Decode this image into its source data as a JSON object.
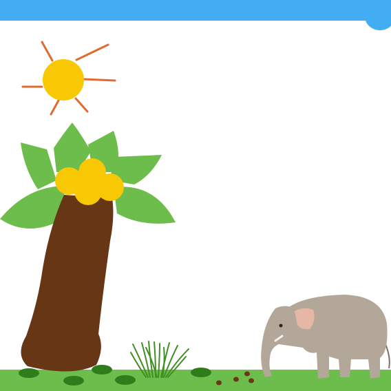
{
  "scene": {
    "sprites": [
      {
        "name": "sun",
        "icon": "sun-icon"
      },
      {
        "name": "palm-tree",
        "icon": "palm-tree-icon"
      },
      {
        "name": "grass-tuft",
        "icon": "grass-icon"
      },
      {
        "name": "elephant",
        "icon": "elephant-icon"
      }
    ]
  },
  "colors": {
    "top_bar": "#42adf2",
    "sky": "#ffffff",
    "ground": "#6cbd4b",
    "leaf_spot": "#2e7d1a",
    "sun": "#f8c805",
    "sun_rays": "#e16b2e",
    "trunk": "#673615",
    "palm_leaves": "#6cbd4b",
    "coconuts": "#f8c805",
    "grass": "#3f8e22",
    "elephant_body": "#b2a798",
    "elephant_ear": "#e6b7a5",
    "dung": "#6b3614"
  }
}
